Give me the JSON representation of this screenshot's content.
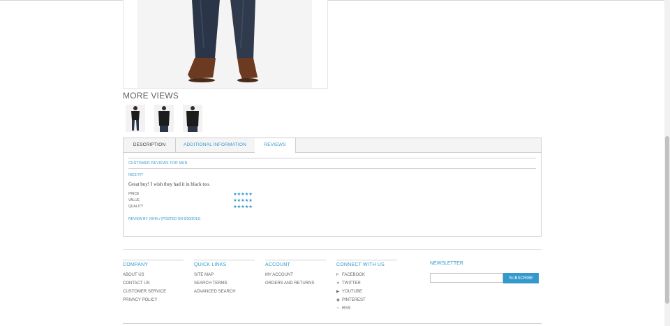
{
  "more_views": {
    "title": "MORE VIEWS"
  },
  "tabs": [
    {
      "label": "DESCRIPTION"
    },
    {
      "label": "ADDITIONAL INFORMATION"
    },
    {
      "label": "REVIEWS"
    }
  ],
  "review": {
    "heading": "CUSTOMER REVIEWS FOR MEN",
    "title": "NICE FIT",
    "body": "Great buy! I wish they had it in black too.",
    "ratings": [
      {
        "label": "PRICE",
        "stars": "★★★★★",
        "value": 5
      },
      {
        "label": "VALUE",
        "stars": "★★★★★",
        "value": 5
      },
      {
        "label": "QUALITY",
        "stars": "★★★★★",
        "value": 5
      }
    ],
    "byline": "REVIEW BY JOHN / (POSTED ON 5/20/2013)"
  },
  "footer": {
    "company": {
      "title": "COMPANY",
      "items": [
        "ABOUT US",
        "CONTACT US",
        "CUSTOMER SERVICE",
        "PRIVACY POLICY"
      ]
    },
    "quick_links": {
      "title": "QUICK LINKS",
      "items": [
        "SITE MAP",
        "SEARCH TERMS",
        "ADVANCED SEARCH"
      ]
    },
    "account": {
      "title": "ACCOUNT",
      "items": [
        "MY ACCOUNT",
        "ORDERS AND RETURNS"
      ]
    },
    "connect": {
      "title": "CONNECT WITH US",
      "items": [
        {
          "icon": "facebook-icon",
          "glyph": "f",
          "label": "FACEBOOK"
        },
        {
          "icon": "twitter-icon",
          "glyph": "🐦",
          "label": "TWITTER"
        },
        {
          "icon": "youtube-icon",
          "glyph": "▶",
          "label": "YOUTUBE"
        },
        {
          "icon": "pinterest-icon",
          "glyph": "℗",
          "label": "PINTEREST"
        },
        {
          "icon": "rss-icon",
          "glyph": "⌇",
          "label": "RSS"
        }
      ]
    },
    "newsletter": {
      "title": "NEWSLETTER",
      "placeholder": "",
      "button": "SUBSCRIBE"
    }
  },
  "colors": {
    "accent": "#3399cc",
    "text": "#636363",
    "border": "#cfcfcf"
  }
}
